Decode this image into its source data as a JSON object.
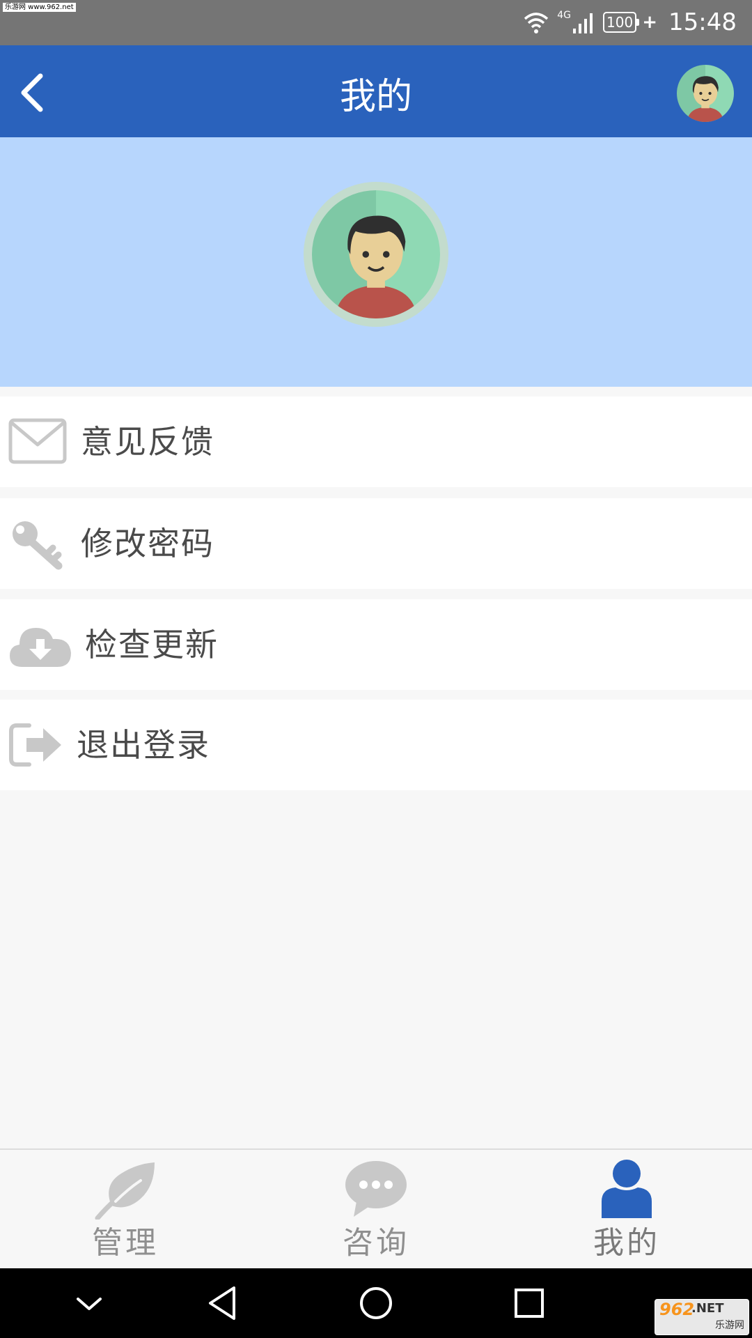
{
  "status_bar": {
    "watermark": "乐游网 www.962.net",
    "network": "4G",
    "battery": "100",
    "time": "15:48"
  },
  "header": {
    "title": "我的",
    "back_icon": "chevron-left-icon",
    "avatar_icon": "user-avatar-icon"
  },
  "menu": {
    "items": [
      {
        "label": "意见反馈",
        "icon": "envelope-icon"
      },
      {
        "label": "修改密码",
        "icon": "key-icon"
      },
      {
        "label": "检查更新",
        "icon": "cloud-download-icon"
      },
      {
        "label": "退出登录",
        "icon": "logout-icon"
      }
    ]
  },
  "bottom_nav": {
    "tabs": [
      {
        "label": "管理",
        "icon": "leaf-icon",
        "active": false
      },
      {
        "label": "咨询",
        "icon": "chat-bubble-icon",
        "active": false
      },
      {
        "label": "我的",
        "icon": "person-icon",
        "active": true
      }
    ]
  },
  "watermark_bottom": {
    "main": "962",
    "suffix": ".NET",
    "sub": "乐游网"
  },
  "colors": {
    "app_bar": "#2a62bc",
    "banner": "#b7d6fd",
    "active_icon": "#2a62bc",
    "inactive_icon": "#c8c8c8"
  }
}
